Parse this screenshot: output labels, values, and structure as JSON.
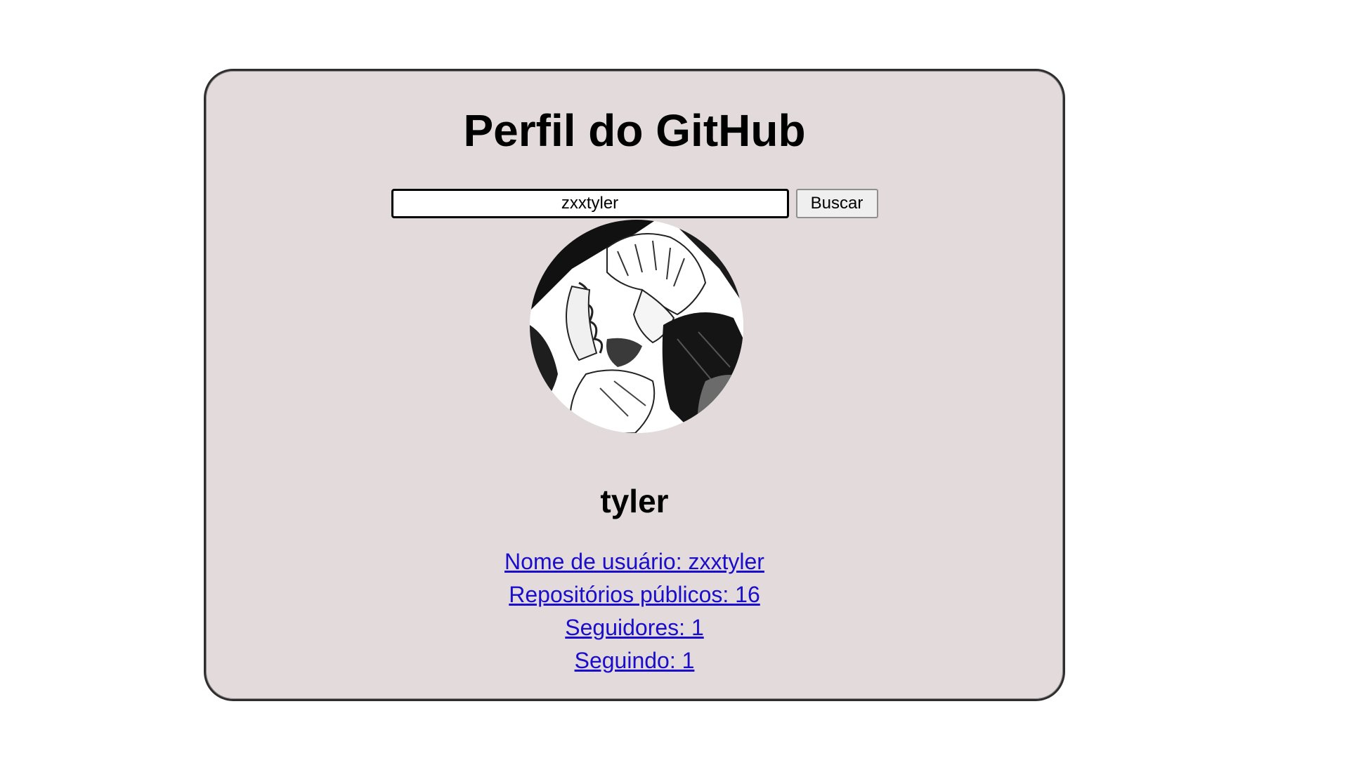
{
  "header": {
    "title": "Perfil do GitHub"
  },
  "search": {
    "value": "zxxtyler",
    "button_label": "Buscar"
  },
  "profile": {
    "avatar_icon": "user-avatar-manga-portrait",
    "name": "tyler",
    "links": [
      {
        "label": "Nome de usuário: zxxtyler"
      },
      {
        "label": "Repositórios públicos: 16"
      },
      {
        "label": "Seguidores: 1"
      },
      {
        "label": "Seguindo: 1"
      }
    ]
  },
  "colors": {
    "card_background": "#e3dbdb",
    "card_border": "#2e2e2e",
    "link": "#1a0dcc",
    "page_background": "#ffffff"
  }
}
